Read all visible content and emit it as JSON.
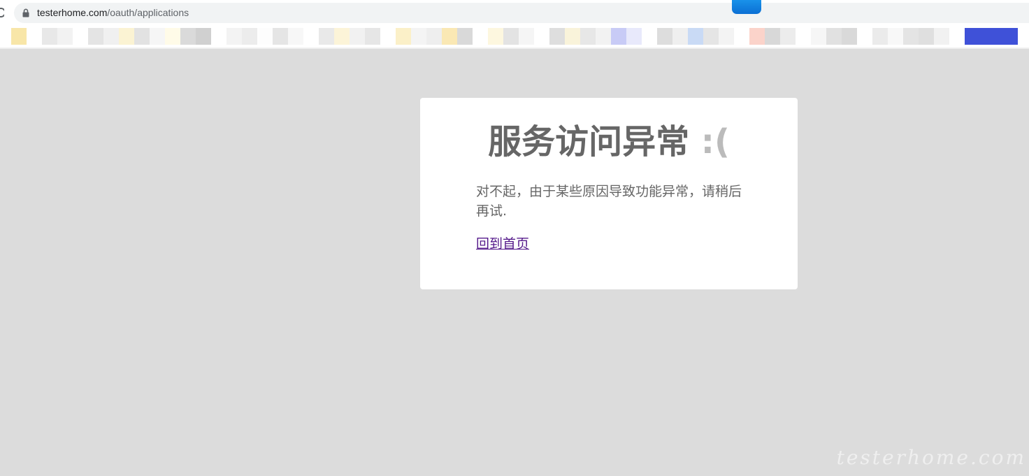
{
  "browser": {
    "url_host": "testerhome.com",
    "url_path": "/oauth/applications"
  },
  "bookmarks": {
    "colors": [
      "#f8e6a8",
      "#ffffff",
      "#e8e8e8",
      "#f2f2f2",
      "#ffffff",
      "#e4e4e4",
      "#f0f0f0",
      "#fbf3d3",
      "#e2e2e2",
      "#f6f6f6",
      "#fffbe8",
      "#dadada",
      "#d0d0d0",
      "#ffffff",
      "#f3f3f3",
      "#ececec",
      "#fdfdfd",
      "#e5e5e5",
      "#f7f7f7",
      "#ffffff",
      "#e9e9e9",
      "#fcf4d8",
      "#f1f1f1",
      "#e6e6e6",
      "#ffffff",
      "#fbf0c8",
      "#f4f4f4",
      "#eeeeee",
      "#fae8b4",
      "#d9d9d9",
      "#ffffff",
      "#fdf7df",
      "#e3e3e3",
      "#f5f5f5",
      "#ffffff",
      "#dedede",
      "#f9f3da",
      "#e7e7e7",
      "#f2f2f2",
      "#c8cbf6",
      "#e8e9fb",
      "#ffffff",
      "#dddddd",
      "#efefef",
      "#c9daf5",
      "#e5e5e5",
      "#f3f3f3",
      "#ffffff",
      "#fbd3ca",
      "#d8d8d8",
      "#ececec",
      "#ffffff",
      "#f6f6f6",
      "#e1e1e1",
      "#d9d9d9",
      "#ffffff",
      "#ebebeb",
      "#f8f8f8",
      "#e4e4e4",
      "#dfdfdf",
      "#f1f1f1",
      "#ffffff",
      "#3f51d8"
    ]
  },
  "error": {
    "title": "服务访问异常",
    "face": ":(",
    "message": "对不起，由于某些原因导致功能异常，请稍后再试.",
    "home_link": "回到首页"
  },
  "watermark": "testerhome.com"
}
